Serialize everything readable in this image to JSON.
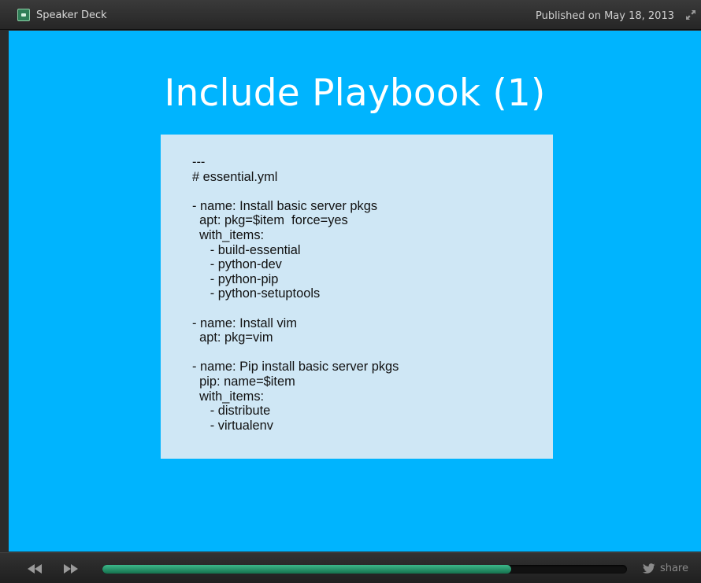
{
  "topbar": {
    "brand_icon": "speaker-deck-logo-icon",
    "brand_name": "Speaker Deck",
    "published": "Published on May 18, 2013",
    "expand_icon": "expand-arrows-icon"
  },
  "slide": {
    "title": "Include Playbook (1)",
    "background_color": "#00b4fe",
    "code_background": "#cfe7f5",
    "code_lines": [
      "---",
      "# essential.yml",
      "",
      "- name: Install basic server pkgs",
      "  apt: pkg=$item  force=yes",
      "  with_items:",
      "     - build-essential",
      "     - python-dev",
      "     - python-pip",
      "     - python-setuptools",
      "",
      "- name: Install vim",
      "  apt: pkg=vim",
      "",
      "- name: Pip install basic server pkgs",
      "  pip: name=$item",
      "  with_items:",
      "     - distribute",
      "     - virtualenv"
    ]
  },
  "controls": {
    "prev_icon": "rewind-icon",
    "next_icon": "fast-forward-icon",
    "progress_fraction": 0.78,
    "progress_color": "#2aa070",
    "share_icon": "twitter-bird-icon",
    "share_label": "share"
  }
}
